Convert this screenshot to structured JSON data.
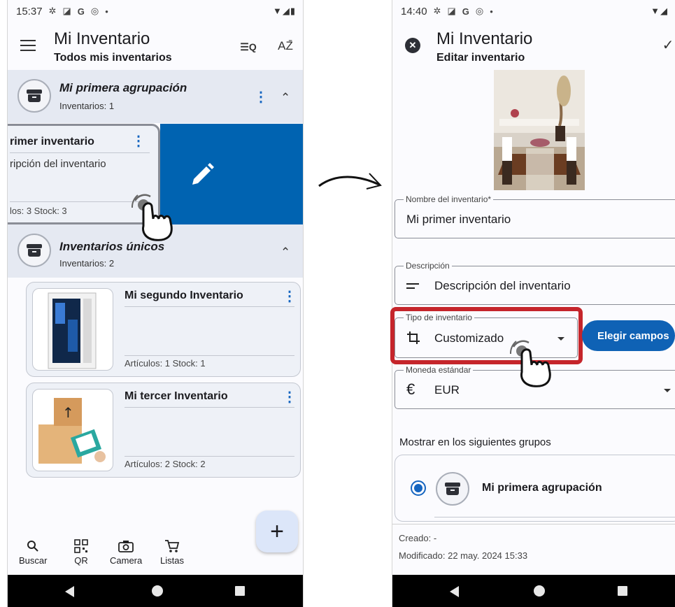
{
  "left": {
    "status": {
      "time": "15:37",
      "icons": [
        "gear-icon",
        "a-icon",
        "g-icon",
        "at-icon",
        "dot-icon"
      ],
      "indicators": "▼◢▮"
    },
    "appbar": {
      "title": "Mi Inventario",
      "subtitle": "Todos mis inventarios"
    },
    "groups": [
      {
        "name": "Mi primera agrupación",
        "count": "Inventarios: 1",
        "cards": [
          {
            "title": "rimer inventario",
            "desc": "ripción del inventario",
            "stats": "los: 3   Stock: 3"
          }
        ]
      },
      {
        "name": "Inventarios únicos",
        "count": "Inventarios: 2",
        "cards": [
          {
            "title": "Mi segundo Inventario",
            "stats": "Artículos: 1   Stock: 1",
            "thumb_icon": "pc-tower-icon"
          },
          {
            "title": "Mi tercer Inventario",
            "stats": "Artículos: 2   Stock: 2",
            "thumb_icon": "boxes-checklist-icon"
          }
        ]
      }
    ],
    "fab_label": "+",
    "nav": [
      {
        "label": "Buscar",
        "icon": "search-icon"
      },
      {
        "label": "QR",
        "icon": "qr-icon"
      },
      {
        "label": "Camera",
        "icon": "camera-icon"
      },
      {
        "label": "Listas",
        "icon": "cart-icon"
      }
    ]
  },
  "right": {
    "status": {
      "time": "14:40",
      "icons": [
        "gear-icon",
        "a-icon",
        "g-icon",
        "at-icon",
        "dot-icon"
      ],
      "indicators": "▼◢"
    },
    "appbar": {
      "title": "Mi Inventario",
      "subtitle": "Editar inventario"
    },
    "fields": {
      "name": {
        "label": "Nombre del inventario*",
        "value": "Mi primer inventario"
      },
      "description": {
        "label": "Descripción",
        "value": "Descripción del inventario"
      },
      "type": {
        "label": "Tipo de inventario",
        "value": "Customizado"
      },
      "currency": {
        "label": "Moneda estándar",
        "value": "EUR",
        "symbol": "€"
      }
    },
    "choose_fields_button": "Elegir campos",
    "show_in_groups_label": "Mostrar en los siguientes grupos",
    "group_option": "Mi primera agrupación",
    "created": "Creado: -",
    "modified": "Modificado: 22 may. 2024 15:33"
  },
  "colors": {
    "accent": "#0f62b5",
    "swipe_bg": "#0063b1",
    "highlight": "#c5252b",
    "group_bg": "#e5e9f2"
  }
}
